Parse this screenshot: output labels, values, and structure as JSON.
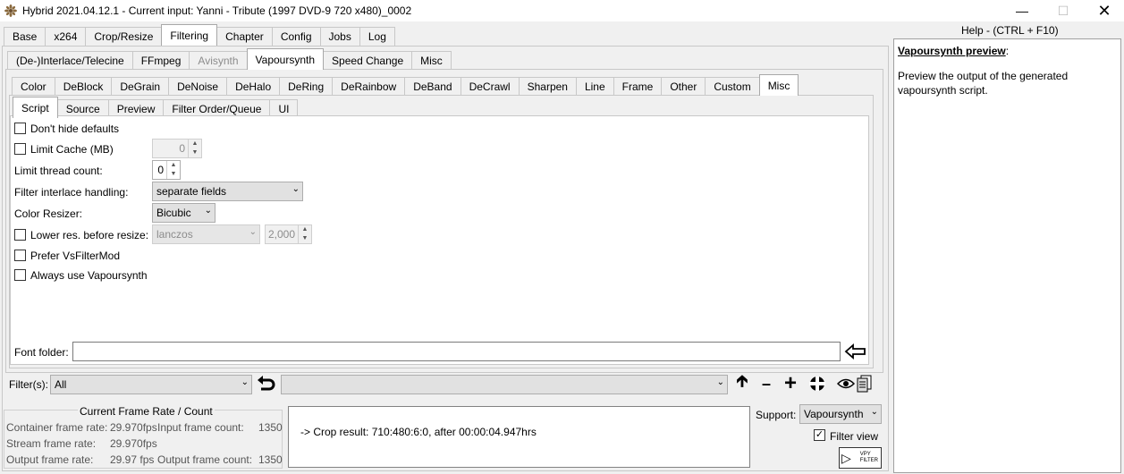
{
  "window": {
    "title": "Hybrid 2021.04.12.1 - Current input: Yanni - Tribute (1997 DVD-9 720 x480)_0002",
    "minimize_icon": "minimize-icon",
    "maximize_icon": "maximize-icon",
    "close_icon": "close-icon"
  },
  "main_tabs": [
    "Base",
    "x264",
    "Crop/Resize",
    "Filtering",
    "Chapter",
    "Config",
    "Jobs",
    "Log"
  ],
  "sub_tabs": [
    "(De-)Interlace/Telecine",
    "FFmpeg",
    "Avisynth",
    "Vapoursynth",
    "Speed Change",
    "Misc"
  ],
  "filter_tabs": [
    "Color",
    "DeBlock",
    "DeGrain",
    "DeNoise",
    "DeHalo",
    "DeRing",
    "DeRainbow",
    "DeBand",
    "DeCrawl",
    "Sharpen",
    "Line",
    "Frame",
    "Other",
    "Custom",
    "Misc"
  ],
  "misc_tabs": [
    "Script",
    "Source",
    "Preview",
    "Filter Order/Queue",
    "UI"
  ],
  "script": {
    "dont_hide_defaults": "Don't hide defaults",
    "limit_cache": "Limit Cache (MB)",
    "limit_cache_value": "0",
    "limit_thread": "Limit thread count:",
    "limit_thread_value": "0",
    "interlace_handling": "Filter interlace handling:",
    "interlace_value": "separate fields",
    "color_resizer": "Color Resizer:",
    "color_resizer_value": "Bicubic",
    "lower_res": "Lower res. before resize:",
    "lower_res_value": "lanczos",
    "lower_res_number": "2,000",
    "prefer_vsfiltermod": "Prefer VsFilterMod",
    "always_vapoursynth": "Always use Vapoursynth",
    "font_folder": "Font folder:",
    "font_folder_value": ""
  },
  "filters_bar": {
    "label": "Filter(s):",
    "value": "All",
    "second_value": ""
  },
  "frame_info": {
    "title": "Current Frame Rate / Count",
    "container_rate_label": "Container frame rate:",
    "container_rate": "29.970fps",
    "input_count_label": "Input frame count:",
    "input_count": "1350",
    "stream_rate_label": "Stream frame rate:",
    "stream_rate": "29.970fps",
    "output_rate_label": "Output frame rate:",
    "output_rate": "29.97 fps",
    "output_count_label": "Output frame count:",
    "output_count": "1350"
  },
  "log_message": "-> Crop result: 710:480:6:0, after 00:00:04.947hrs",
  "support": {
    "label": "Support:",
    "value": "Vapoursynth",
    "filter_view": "Filter view",
    "filter_view_checked": true,
    "vpy_badge": "VPY FILTER"
  },
  "help": {
    "header": "Help - (CTRL + F10)",
    "title": "Vapoursynth preview",
    "title_suffix": ":",
    "body": "Preview the output of the generated vapoursynth script."
  }
}
